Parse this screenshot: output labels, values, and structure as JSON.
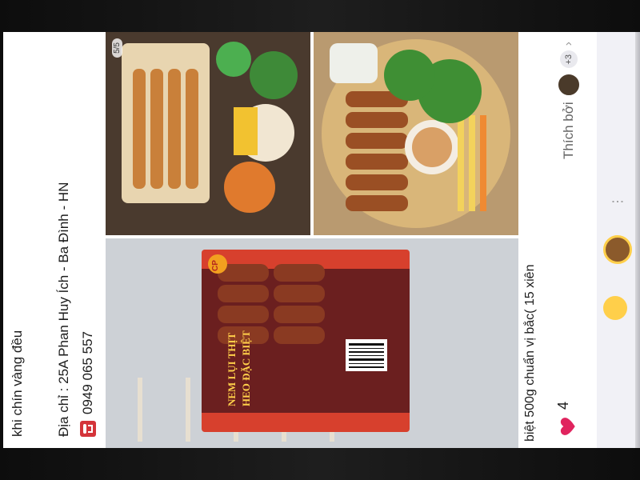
{
  "post": {
    "line1": "khi chín vàng đều",
    "address": "Địa chỉ : 25A Phan Huy Ích - Ba Đình - HN",
    "phone": "0949 065 557",
    "caption": "biệt 500g chuẩn vị bắc( 15 xiên"
  },
  "photos": {
    "page_indicator": "5/5",
    "package": {
      "brand": "CP",
      "title_line1": "NEM LỤI THỊT",
      "title_line2": "HEO ĐẶC BIỆT"
    }
  },
  "social": {
    "likes_count": "4",
    "liked_by_label": "Thích bởi",
    "more_count": "+3",
    "chevron": "›"
  },
  "icons": [
    "phone-icon",
    "heart-icon",
    "chevron-right-icon",
    "reaction-emoji-icon"
  ],
  "colors": {
    "heart": "#e0245e",
    "phone_icon": "#d4343a",
    "package_red": "#d7402d",
    "package_maroon": "#6b1f1f"
  }
}
